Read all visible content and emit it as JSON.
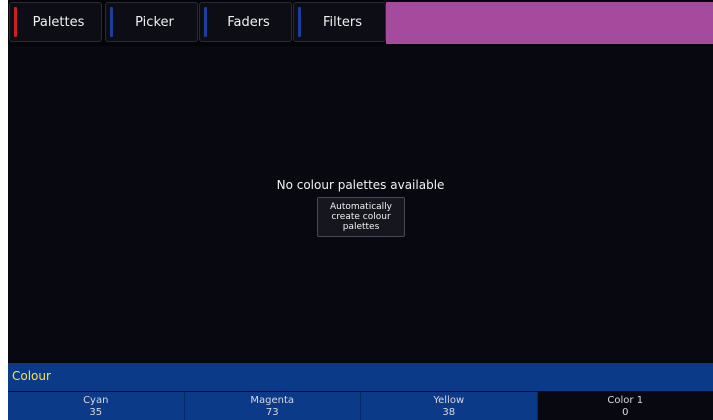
{
  "tabs": [
    {
      "label": "Palettes",
      "stripe_color": "#cc1f1f",
      "active": true
    },
    {
      "label": "Picker",
      "stripe_color": "#1d3d9a",
      "active": false
    },
    {
      "label": "Faders",
      "stripe_color": "#1d3d9a",
      "active": false
    },
    {
      "label": "Filters",
      "stripe_color": "#1d3d9a",
      "active": false
    }
  ],
  "main": {
    "empty_message": "No colour palettes available",
    "auto_button_label": "Automatically\ncreate colour\npalettes"
  },
  "section": {
    "title": "Colour"
  },
  "encoders": [
    {
      "name": "Cyan",
      "value": "35"
    },
    {
      "name": "Magenta",
      "value": "73"
    },
    {
      "name": "Yellow",
      "value": "38"
    },
    {
      "name": "Color 1",
      "value": "0"
    }
  ],
  "colors": {
    "accent_title": "#a54b9d",
    "section_bar": "#0a3a88",
    "section_text": "#ffe14a"
  }
}
